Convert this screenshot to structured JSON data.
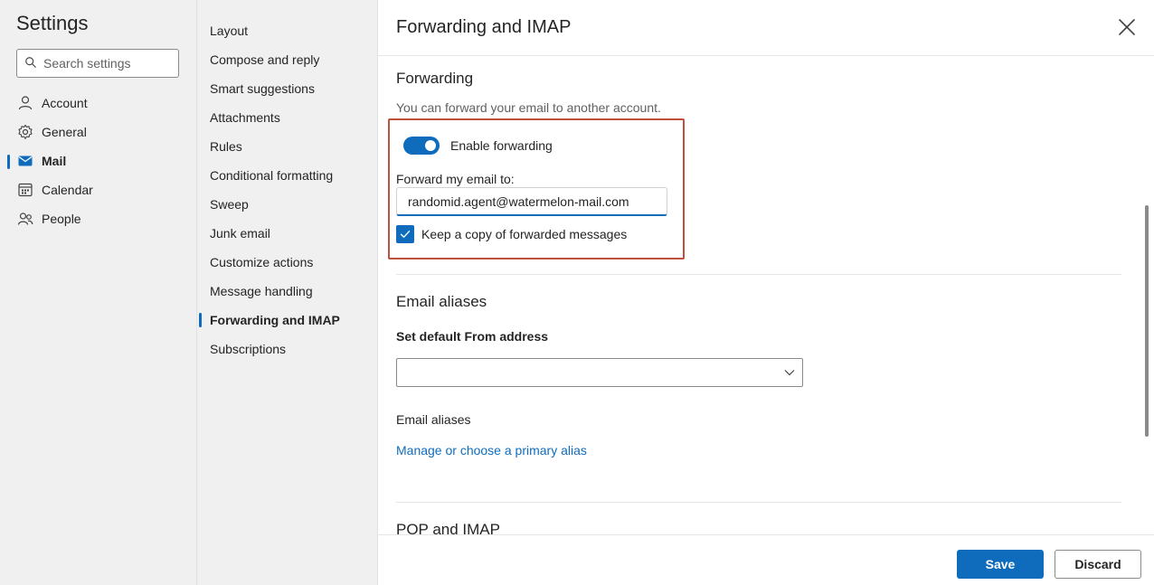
{
  "sidebar": {
    "title": "Settings",
    "search_placeholder": "Search settings",
    "categories": [
      {
        "label": "Account",
        "icon": "person-icon"
      },
      {
        "label": "General",
        "icon": "gear-icon"
      },
      {
        "label": "Mail",
        "icon": "mail-icon",
        "active": true
      },
      {
        "label": "Calendar",
        "icon": "calendar-icon"
      },
      {
        "label": "People",
        "icon": "people-icon"
      }
    ]
  },
  "mail_nav": {
    "items": [
      "Layout",
      "Compose and reply",
      "Smart suggestions",
      "Attachments",
      "Rules",
      "Conditional formatting",
      "Sweep",
      "Junk email",
      "Customize actions",
      "Message handling",
      "Forwarding and IMAP",
      "Subscriptions"
    ],
    "active_item": "Forwarding and IMAP"
  },
  "main": {
    "title": "Forwarding and IMAP",
    "forwarding": {
      "heading": "Forwarding",
      "description": "You can forward your email to another account.",
      "toggle_label": "Enable forwarding",
      "toggle_on": true,
      "forward_label": "Forward my email to:",
      "forward_value": "randomid.agent@watermelon-mail.com",
      "keep_copy_label": "Keep a copy of forwarded messages",
      "keep_copy_checked": true
    },
    "aliases": {
      "heading": "Email aliases",
      "default_from_label": "Set default From address",
      "default_from_value": "",
      "aliases_label": "Email aliases",
      "manage_link": "Manage or choose a primary alias"
    },
    "pop_imap": {
      "heading": "POP and IMAP"
    }
  },
  "footer": {
    "save_label": "Save",
    "discard_label": "Discard"
  },
  "colors": {
    "accent": "#0f6cbd",
    "highlight_border": "#c0503a",
    "sidebar_bg": "#f0f0f0"
  }
}
